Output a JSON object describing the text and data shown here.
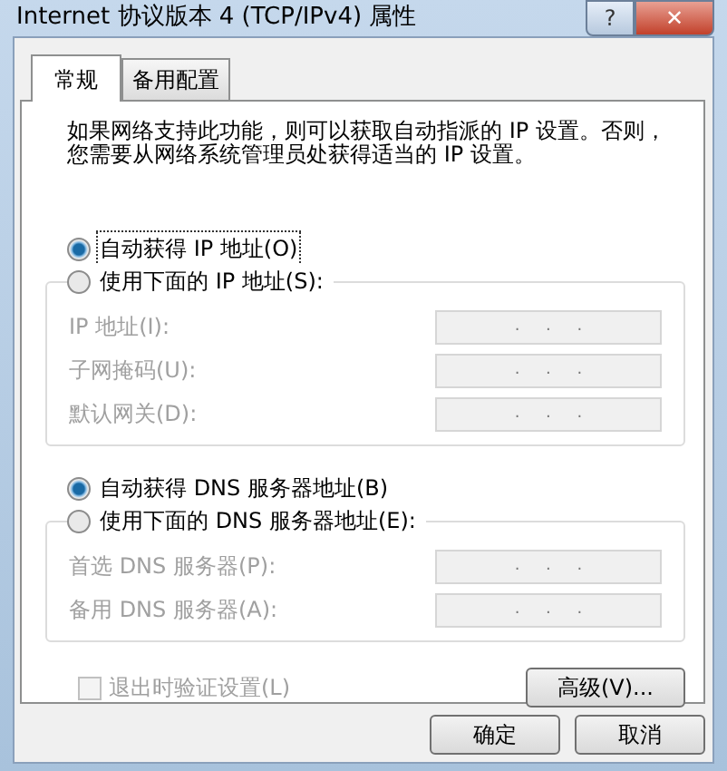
{
  "window": {
    "title": "Internet 协议版本 4 (TCP/IPv4) 属性",
    "help_button": "?",
    "close_button": "✕"
  },
  "tabs": [
    {
      "label": "常规",
      "selected": true
    },
    {
      "label": "备用配置",
      "selected": false
    }
  ],
  "description": "如果网络支持此功能，则可以获取自动指派的 IP 设置。否则，您需要从网络系统管理员处获得适当的 IP 设置。",
  "sections": [
    {
      "radios": [
        {
          "label": "自动获得 IP 地址(O)",
          "selected": true,
          "focused": true
        },
        {
          "label": "使用下面的 IP 地址(S):",
          "selected": false,
          "focused": false
        }
      ],
      "disabled": true,
      "fields": [
        {
          "label": "IP 地址(I):",
          "value": ".     .     ."
        },
        {
          "label": "子网掩码(U):",
          "value": ".     .     ."
        },
        {
          "label": "默认网关(D):",
          "value": ".     .     ."
        }
      ]
    },
    {
      "radios": [
        {
          "label": "自动获得 DNS 服务器地址(B)",
          "selected": true,
          "focused": false
        },
        {
          "label": "使用下面的 DNS 服务器地址(E):",
          "selected": false,
          "focused": false
        }
      ],
      "disabled": true,
      "fields": [
        {
          "label": "首选 DNS 服务器(P):",
          "value": ".     .     ."
        },
        {
          "label": "备用 DNS 服务器(A):",
          "value": ".     .     ."
        }
      ]
    }
  ],
  "validate_checkbox": {
    "label": "退出时验证设置(L)",
    "checked": false,
    "disabled": true
  },
  "advanced_button": "高级(V)...",
  "buttons": [
    "确定",
    "取消"
  ]
}
